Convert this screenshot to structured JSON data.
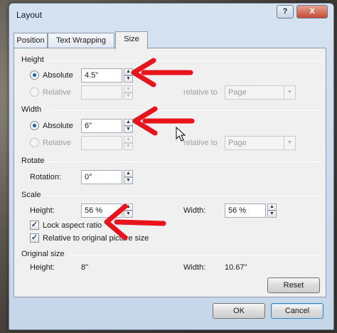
{
  "window": {
    "title": "Layout",
    "help_label": "?",
    "close_label": "X"
  },
  "tabs": [
    {
      "label": "Position"
    },
    {
      "label": "Text Wrapping"
    },
    {
      "label": "Size"
    }
  ],
  "height": {
    "heading": "Height",
    "absolute_label": "Absolute",
    "absolute_value": "4.5\"",
    "relative_label": "Relative",
    "relative_value": "",
    "relative_to_label": "relative to",
    "relative_to_value": "Page"
  },
  "width": {
    "heading": "Width",
    "absolute_label": "Absolute",
    "absolute_value": "6\"",
    "relative_label": "Relative",
    "relative_value": "",
    "relative_to_label": "relative to",
    "relative_to_value": "Page"
  },
  "rotate": {
    "heading": "Rotate",
    "rotation_label": "Rotation:",
    "rotation_value": "0°"
  },
  "scale": {
    "heading": "Scale",
    "height_label": "Height:",
    "height_value": "56 %",
    "width_label": "Width:",
    "width_value": "56 %",
    "lock_aspect_label": "Lock aspect ratio",
    "lock_aspect_checked": true,
    "relative_original_label": "Relative to original picture size",
    "relative_original_checked": true
  },
  "original_size": {
    "heading": "Original size",
    "height_label": "Height:",
    "height_value": "8\"",
    "width_label": "Width:",
    "width_value": "10.67\""
  },
  "buttons": {
    "reset": "Reset",
    "ok": "OK",
    "cancel": "Cancel"
  },
  "colors": {
    "annotation_arrow": "#e8141c",
    "dialog_bg": "#f0f0f0",
    "titlebar": "#c6d6e9"
  },
  "icons": {
    "checkbox_mark": "✓",
    "spin_up": "▲",
    "spin_down": "▼",
    "dropdown": "▼"
  }
}
